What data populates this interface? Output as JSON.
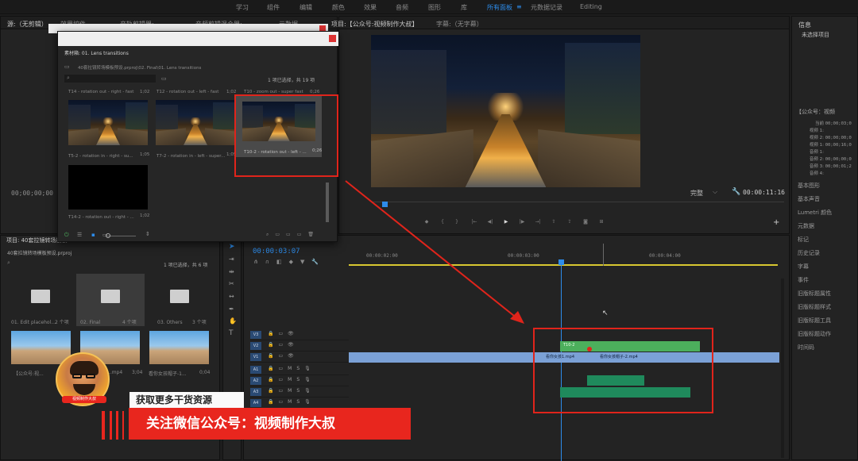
{
  "workspace": {
    "items": [
      "学习",
      "组件",
      "编辑",
      "颜色",
      "效果",
      "音频",
      "图形",
      "库",
      "所有面板",
      "元数据记录",
      "Editing"
    ],
    "active_index": 8,
    "menu_icon": "hamburger-icon"
  },
  "top_left_tabs": [
    "源:（无剪辑）",
    "效果控件",
    "音轨剪辑器:",
    "音频剪辑混合器:",
    "元数据"
  ],
  "project_tab_right": "项目:【公众号:视频制作大叔】",
  "program_tab": "字幕:（无字幕）",
  "source_timecode": "00;00;00;00",
  "bin": {
    "title": "素材箱: 01. Lens transitions",
    "path": "40套拉镜转场模板预设.prproj\\02. Final\\01. Lens transitions",
    "status": "1 项已选择，共 19 项",
    "items": [
      {
        "label": "T14 - rotation out - right - fast",
        "dur": "1;02"
      },
      {
        "label": "T12 - rotation out - left - fast",
        "dur": "1;02"
      },
      {
        "label": "T10 - zoom out - super fast",
        "dur": "0;26"
      },
      {
        "label": "T5-2 - rotation in - right - su...",
        "dur": "1;05"
      },
      {
        "label": "T7-2 - rotation in - left - super...",
        "dur": "1;05"
      },
      {
        "label": "T10-2 - rotation out - left - ...",
        "dur": "0;26"
      },
      {
        "label": "T14-2 - rotation out - right - ...",
        "dur": "1;02"
      }
    ]
  },
  "program": {
    "fit": "完整",
    "timecode": "00:00:11:16"
  },
  "project": {
    "title": "项目: 40套拉镜转场模板",
    "file": "40套拉镜转场模板预设.prproj",
    "status": "1 项已选择，共 6 项",
    "folders": [
      {
        "name": "01. Edit placehol...",
        "count": "2 个项"
      },
      {
        "name": "02. Final",
        "count": "4 个项"
      },
      {
        "name": "03. Others",
        "count": "3 个项"
      }
    ],
    "clips": [
      {
        "name": "【公众号:视...",
        "dur": "3;04"
      },
      {
        "name": "...mp4",
        "dur": "3;04"
      },
      {
        "name": "看你女孩帽子-1...",
        "dur": "0;04"
      }
    ]
  },
  "timeline": {
    "timecode": "00:00:03:07",
    "ruler": [
      "00:00:02:00",
      "00:00:03:00",
      "00:00:04:00"
    ],
    "video_tracks": [
      "V3",
      "V2",
      "V1"
    ],
    "audio_tracks": [
      "A1",
      "A2",
      "A3",
      "A4"
    ],
    "clip_v3": "T10-2",
    "clip_v1_a": "看你女孩1.mp4",
    "clip_v1_b": "看你女孩帽子-2.mp4"
  },
  "right_panel": {
    "title": "信息",
    "subtitle": "未选择项目",
    "info_label": "【公众号：视频",
    "info_rows": [
      {
        "k": "当前",
        "v": "00;00;03;0"
      },
      {
        "k": "视频 1:",
        "v": ""
      },
      {
        "k": "视频 2:",
        "v": "00;00;00;0"
      },
      {
        "k": "视频 1:",
        "v": "00;00;16;0"
      },
      {
        "k": "音频 1:",
        "v": ""
      },
      {
        "k": "音频 2:",
        "v": "00;00;00;0"
      },
      {
        "k": "音频 3:",
        "v": "00;00;01;2"
      },
      {
        "k": "音频 4:",
        "v": ""
      }
    ],
    "panels": [
      "基本图形",
      "基本声音",
      "Lumetri 颜色",
      "元数据",
      "标记",
      "历史记录",
      "字幕",
      "事件",
      "旧版标题属性",
      "旧版标题样式",
      "旧版标题工具",
      "旧版标题动作",
      "时间码"
    ]
  },
  "overlay": {
    "line1": "获取更多干货资源",
    "line2": "关注微信公众号：视频制作大叔",
    "avatar_text": "视频制作大叔",
    "accent": "#e8261e"
  },
  "colors": {
    "accent_blue": "#2d8ceb",
    "clip_green": "#4caf5c",
    "clip_blue": "#7ba1d6",
    "audio_green": "#1f8a5c",
    "highlight_red": "#e0241b"
  }
}
